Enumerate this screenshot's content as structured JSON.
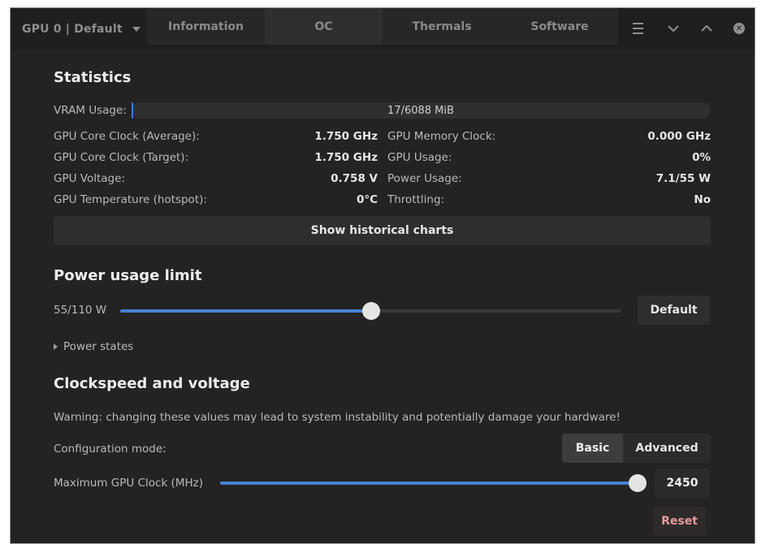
{
  "header": {
    "gpu_selector": "GPU 0 | Default",
    "tabs": [
      "Information",
      "OC",
      "Thermals",
      "Software"
    ],
    "active_tab": "OC",
    "icons": [
      "menu-icon",
      "chevron-down-icon",
      "chevron-up-icon",
      "close-icon"
    ]
  },
  "statistics": {
    "title": "Statistics",
    "vram": {
      "label": "VRAM Usage:",
      "text": "17/6088 MiB",
      "used_fraction": 0.003
    },
    "left": [
      {
        "label": "GPU Core Clock (Average):",
        "value": "1.750 GHz"
      },
      {
        "label": "GPU Core Clock (Target):",
        "value": "1.750 GHz"
      },
      {
        "label": "GPU Voltage:",
        "value": "0.758 V"
      },
      {
        "label": "GPU Temperature (hotspot):",
        "value": "0°C"
      }
    ],
    "right": [
      {
        "label": "GPU Memory Clock:",
        "value": "0.000 GHz"
      },
      {
        "label": "GPU Usage:",
        "value": "0%"
      },
      {
        "label": "Power Usage:",
        "value": "7.1/55 W"
      },
      {
        "label": "Throttling:",
        "value": "No"
      }
    ],
    "history_button": "Show historical charts"
  },
  "power": {
    "title": "Power usage limit",
    "value_text": "55/110 W",
    "fraction": 0.5,
    "default_button": "Default",
    "power_states": "Power states"
  },
  "clock": {
    "title": "Clockspeed and voltage",
    "warning": "Warning: changing these values may lead to system instability and potentially damage your hardware!",
    "config_label": "Configuration mode:",
    "modes": [
      "Basic",
      "Advanced"
    ],
    "active_mode": "Basic",
    "max_clock_label": "Maximum GPU Clock (MHz)",
    "max_clock_value": "2450",
    "max_clock_fraction": 1.0,
    "reset_button": "Reset"
  },
  "colors": {
    "window_bg": "#232323",
    "accent": "#4a83d4",
    "reset_text": "#e89a9a"
  }
}
